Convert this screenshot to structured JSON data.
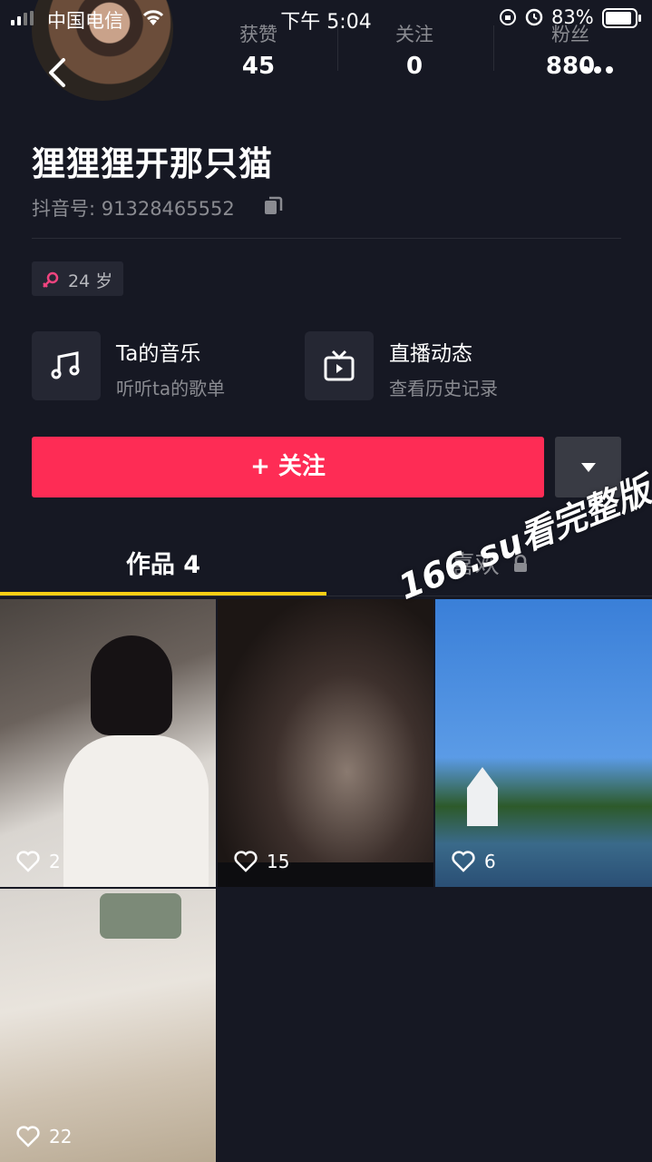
{
  "status_bar": {
    "carrier": "中国电信",
    "time": "下午 5:04",
    "battery": "83%"
  },
  "stats": [
    {
      "label": "获赞",
      "value": "45"
    },
    {
      "label": "关注",
      "value": "0"
    },
    {
      "label": "粉丝",
      "value": "880"
    }
  ],
  "profile": {
    "nickname": "狸狸狸开那只猫",
    "douyin_id": "抖音号: 91328465552",
    "age_tag": "24 岁"
  },
  "features": [
    {
      "title": "Ta的音乐",
      "subtitle": "听听ta的歌单",
      "icon": "music-note-icon"
    },
    {
      "title": "直播动态",
      "subtitle": "查看历史记录",
      "icon": "tv-icon"
    }
  ],
  "follow_button": "+ 关注",
  "tabs": [
    {
      "label": "作品 4"
    },
    {
      "label": "喜欢"
    }
  ],
  "videos": [
    {
      "likes": "2"
    },
    {
      "likes": "15"
    },
    {
      "likes": "6"
    },
    {
      "likes": "22"
    }
  ],
  "watermark": "166.su看完整版",
  "colors": {
    "accent": "#fe2c55",
    "tab_indicator": "#face15",
    "background": "#161823"
  }
}
